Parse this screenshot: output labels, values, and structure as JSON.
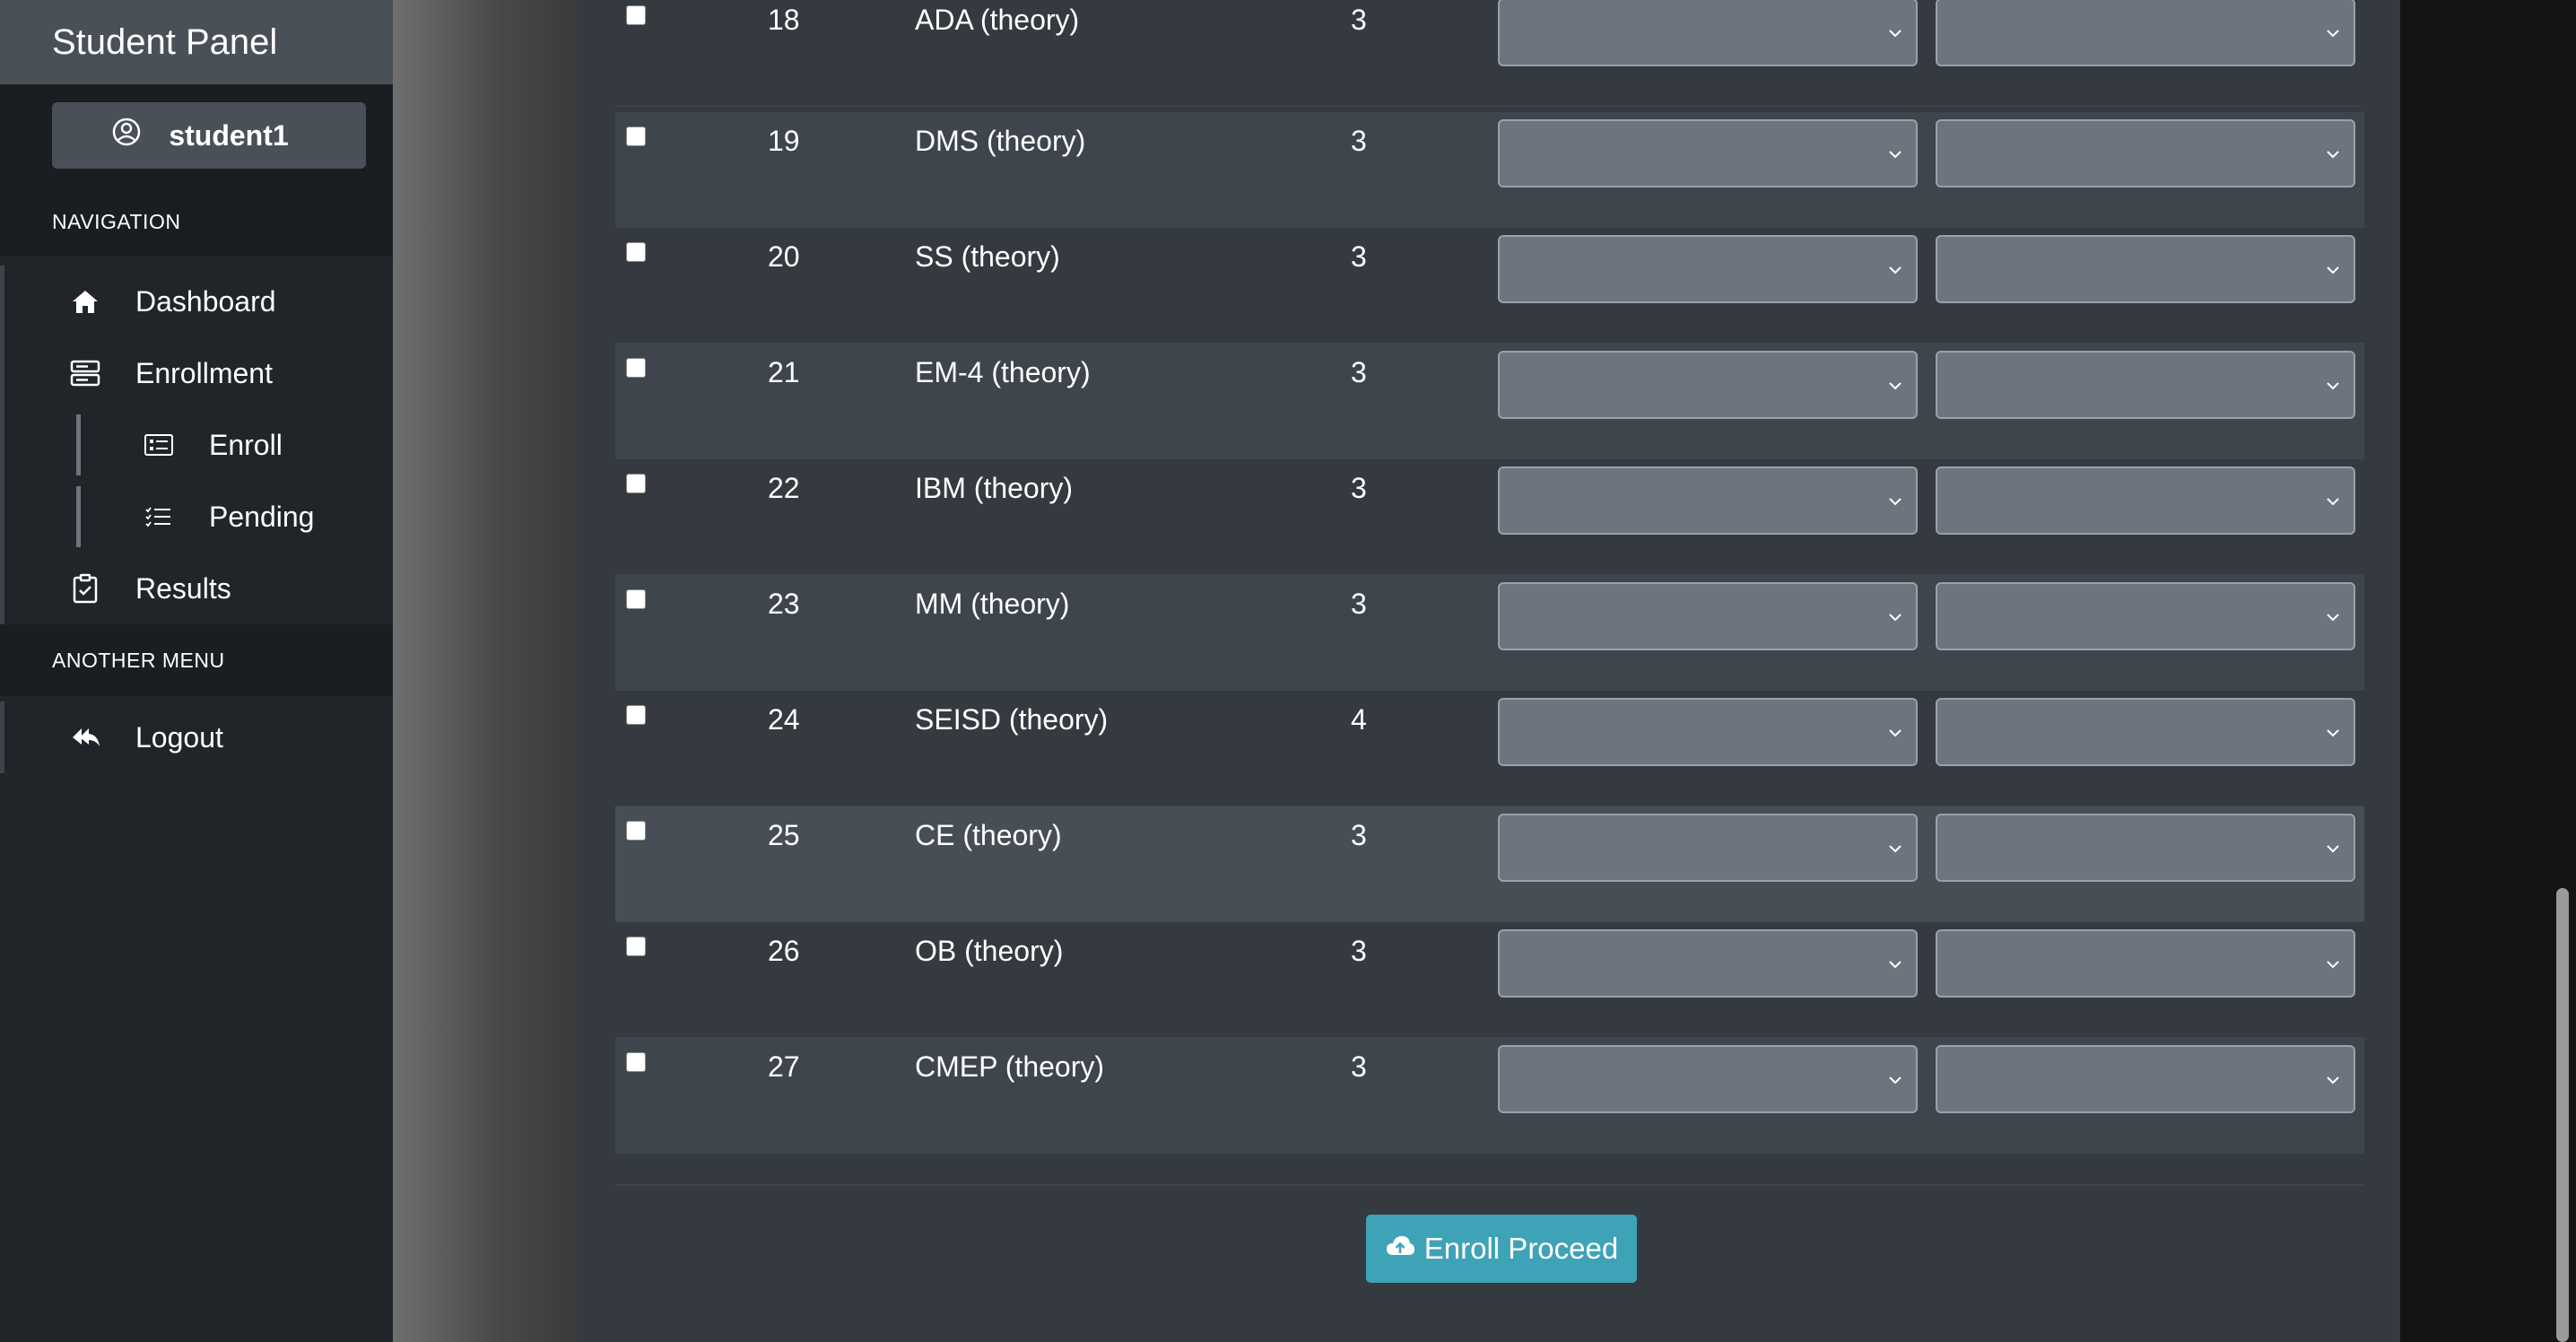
{
  "sidebar": {
    "brand": "Student Panel",
    "user": "student1",
    "sections": {
      "navigation": "NAVIGATION",
      "another": "ANOTHER MENU"
    },
    "items": {
      "dashboard": "Dashboard",
      "enrollment": "Enrollment",
      "enroll": "Enroll",
      "pending": "Pending",
      "results": "Results",
      "logout": "Logout"
    }
  },
  "courses": [
    {
      "no": "18",
      "title": "ADA (theory)",
      "credit": "3"
    },
    {
      "no": "19",
      "title": "DMS (theory)",
      "credit": "3"
    },
    {
      "no": "20",
      "title": "SS (theory)",
      "credit": "3"
    },
    {
      "no": "21",
      "title": "EM-4 (theory)",
      "credit": "3"
    },
    {
      "no": "22",
      "title": "IBM (theory)",
      "credit": "3"
    },
    {
      "no": "23",
      "title": "MM (theory)",
      "credit": "3"
    },
    {
      "no": "24",
      "title": "SEISD (theory)",
      "credit": "4"
    },
    {
      "no": "25",
      "title": "CE (theory)",
      "credit": "3"
    },
    {
      "no": "26",
      "title": "OB (theory)",
      "credit": "3"
    },
    {
      "no": "27",
      "title": "CMEP (theory)",
      "credit": "3"
    }
  ],
  "actions": {
    "enroll_proceed": "Enroll Proceed"
  },
  "colors": {
    "sidebar_bg": "#212529",
    "brand_bg": "#495057",
    "content_bg": "#343a40",
    "select_bg": "#6c757d",
    "button_bg": "#3fa3b8"
  }
}
